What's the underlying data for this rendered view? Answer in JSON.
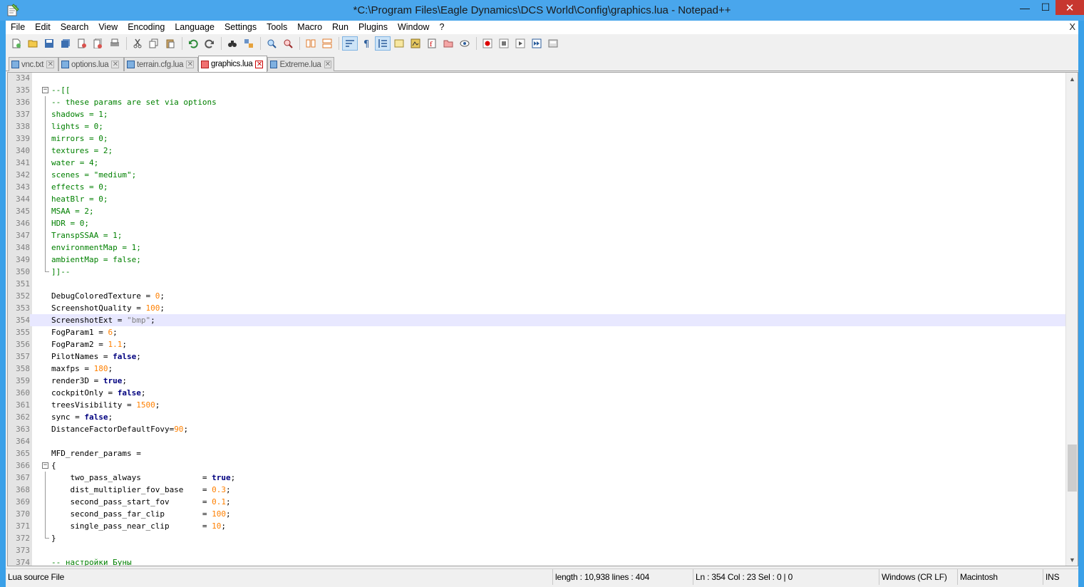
{
  "window": {
    "title": "*C:\\Program Files\\Eagle Dynamics\\DCS World\\Config\\graphics.lua - Notepad++",
    "minimize": "—",
    "maximize": "☐",
    "close": "✕"
  },
  "menu": {
    "items": [
      "File",
      "Edit",
      "Search",
      "View",
      "Encoding",
      "Language",
      "Settings",
      "Tools",
      "Macro",
      "Run",
      "Plugins",
      "Window",
      "?"
    ],
    "close": "X"
  },
  "toolbar": {
    "buttons": [
      "new-file",
      "open-file",
      "save",
      "save-all",
      "close",
      "close-all",
      "print",
      "cut",
      "copy",
      "paste",
      "undo",
      "redo",
      "find",
      "replace",
      "zoom-in",
      "zoom-out",
      "sync-v",
      "sync-h",
      "word-wrap",
      "show-all-chars",
      "indent-guide",
      "user-lang",
      "doc-map",
      "function-list",
      "folder-workspace",
      "monitor",
      "record-macro",
      "stop-record",
      "play-macro",
      "run-macro-multiple",
      "save-macro"
    ]
  },
  "tabs": [
    {
      "label": "vnc.txt",
      "active": false
    },
    {
      "label": "options.lua",
      "active": false
    },
    {
      "label": "terrain.cfg.lua",
      "active": false
    },
    {
      "label": "graphics.lua",
      "active": true
    },
    {
      "label": "Extreme.lua",
      "active": false
    }
  ],
  "editor": {
    "lines": [
      {
        "n": "334",
        "code": "",
        "cls": ""
      },
      {
        "n": "335",
        "code": "--[[",
        "cls": "c-comment",
        "fold": "box"
      },
      {
        "n": "336",
        "code": "-- these params are set via options",
        "cls": "c-comment",
        "fold": "line"
      },
      {
        "n": "337",
        "code": "shadows = 1;",
        "cls": "c-comment",
        "fold": "line"
      },
      {
        "n": "338",
        "code": "lights = 0;",
        "cls": "c-comment",
        "fold": "line"
      },
      {
        "n": "339",
        "code": "mirrors = 0;",
        "cls": "c-comment",
        "fold": "line"
      },
      {
        "n": "340",
        "code": "textures = 2;",
        "cls": "c-comment",
        "fold": "line"
      },
      {
        "n": "341",
        "code": "water = 4;",
        "cls": "c-comment",
        "fold": "line"
      },
      {
        "n": "342",
        "code": "scenes = \"medium\";",
        "cls": "c-comment",
        "fold": "line"
      },
      {
        "n": "343",
        "code": "effects = 0;",
        "cls": "c-comment",
        "fold": "line"
      },
      {
        "n": "344",
        "code": "heatBlr = 0;",
        "cls": "c-comment",
        "fold": "line"
      },
      {
        "n": "345",
        "code": "MSAA = 2;",
        "cls": "c-comment",
        "fold": "line"
      },
      {
        "n": "346",
        "code": "HDR = 0;",
        "cls": "c-comment",
        "fold": "line"
      },
      {
        "n": "347",
        "code": "TranspSSAA = 1;",
        "cls": "c-comment",
        "fold": "line"
      },
      {
        "n": "348",
        "code": "environmentMap = 1;",
        "cls": "c-comment",
        "fold": "line"
      },
      {
        "n": "349",
        "code": "ambientMap = false;",
        "cls": "c-comment",
        "fold": "line"
      },
      {
        "n": "350",
        "code": "]]--",
        "cls": "c-comment",
        "fold": "end"
      },
      {
        "n": "351",
        "code": "",
        "cls": ""
      },
      {
        "n": "352",
        "parts": [
          [
            "DebugColoredTexture = ",
            "c-def"
          ],
          [
            "0",
            "c-num"
          ],
          [
            ";",
            "c-def"
          ]
        ]
      },
      {
        "n": "353",
        "parts": [
          [
            "ScreenshotQuality = ",
            "c-def"
          ],
          [
            "100",
            "c-num"
          ],
          [
            ";",
            "c-def"
          ]
        ]
      },
      {
        "n": "354",
        "parts": [
          [
            "ScreenshotExt = ",
            "c-def"
          ],
          [
            "\"bmp\"",
            "c-str"
          ],
          [
            ";",
            "c-def"
          ]
        ],
        "current": true
      },
      {
        "n": "355",
        "parts": [
          [
            "FogParam1 = ",
            "c-def"
          ],
          [
            "6",
            "c-num"
          ],
          [
            ";",
            "c-def"
          ]
        ]
      },
      {
        "n": "356",
        "parts": [
          [
            "FogParam2 = ",
            "c-def"
          ],
          [
            "1.1",
            "c-num"
          ],
          [
            ";",
            "c-def"
          ]
        ]
      },
      {
        "n": "357",
        "parts": [
          [
            "PilotNames = ",
            "c-def"
          ],
          [
            "false",
            "c-kw"
          ],
          [
            ";",
            "c-def"
          ]
        ]
      },
      {
        "n": "358",
        "parts": [
          [
            "maxfps = ",
            "c-def"
          ],
          [
            "180",
            "c-num"
          ],
          [
            ";",
            "c-def"
          ]
        ]
      },
      {
        "n": "359",
        "parts": [
          [
            "render3D = ",
            "c-def"
          ],
          [
            "true",
            "c-kw"
          ],
          [
            ";",
            "c-def"
          ]
        ]
      },
      {
        "n": "360",
        "parts": [
          [
            "cockpitOnly = ",
            "c-def"
          ],
          [
            "false",
            "c-kw"
          ],
          [
            ";",
            "c-def"
          ]
        ]
      },
      {
        "n": "361",
        "parts": [
          [
            "treesVisibility = ",
            "c-def"
          ],
          [
            "1500",
            "c-num"
          ],
          [
            ";",
            "c-def"
          ]
        ]
      },
      {
        "n": "362",
        "parts": [
          [
            "sync = ",
            "c-def"
          ],
          [
            "false",
            "c-kw"
          ],
          [
            ";",
            "c-def"
          ]
        ]
      },
      {
        "n": "363",
        "parts": [
          [
            "DistanceFactorDefaultFovy=",
            "c-def"
          ],
          [
            "90",
            "c-num"
          ],
          [
            ";",
            "c-def"
          ]
        ]
      },
      {
        "n": "364",
        "code": "",
        "cls": ""
      },
      {
        "n": "365",
        "parts": [
          [
            "MFD_render_params =",
            "c-def"
          ]
        ]
      },
      {
        "n": "366",
        "parts": [
          [
            "{",
            "c-def"
          ]
        ],
        "fold": "box"
      },
      {
        "n": "367",
        "parts": [
          [
            "    two_pass_always             = ",
            "c-def"
          ],
          [
            "true",
            "c-kw"
          ],
          [
            ";",
            "c-def"
          ]
        ],
        "fold": "line"
      },
      {
        "n": "368",
        "parts": [
          [
            "    dist_multiplier_fov_base    = ",
            "c-def"
          ],
          [
            "0.3",
            "c-num"
          ],
          [
            ";",
            "c-def"
          ]
        ],
        "fold": "line"
      },
      {
        "n": "369",
        "parts": [
          [
            "    second_pass_start_fov       = ",
            "c-def"
          ],
          [
            "0.1",
            "c-num"
          ],
          [
            ";",
            "c-def"
          ]
        ],
        "fold": "line"
      },
      {
        "n": "370",
        "parts": [
          [
            "    second_pass_far_clip        = ",
            "c-def"
          ],
          [
            "100",
            "c-num"
          ],
          [
            ";",
            "c-def"
          ]
        ],
        "fold": "line"
      },
      {
        "n": "371",
        "parts": [
          [
            "    single_pass_near_clip       = ",
            "c-def"
          ],
          [
            "10",
            "c-num"
          ],
          [
            ";",
            "c-def"
          ]
        ],
        "fold": "line"
      },
      {
        "n": "372",
        "parts": [
          [
            "}",
            "c-def"
          ]
        ],
        "fold": "end"
      },
      {
        "n": "373",
        "code": "",
        "cls": ""
      },
      {
        "n": "374",
        "code": "-- настройки Буны",
        "cls": "c-comment"
      }
    ]
  },
  "scrollbar": {
    "up": "▲",
    "down": "▼",
    "position_fraction": 0.85
  },
  "statusbar": {
    "file_type": "Lua source File",
    "length": "length : 10,938    lines : 404",
    "position": "Ln : 354    Col : 23    Sel : 0 | 0",
    "eol": "Windows (CR LF)",
    "encoding": "Macintosh",
    "mode": "INS"
  },
  "colors": {
    "titlebar": "#49a6ec",
    "comment": "#008000",
    "number": "#ff8000",
    "string": "#808080",
    "keyword": "#00007f",
    "current_line": "#e8e8ff"
  }
}
